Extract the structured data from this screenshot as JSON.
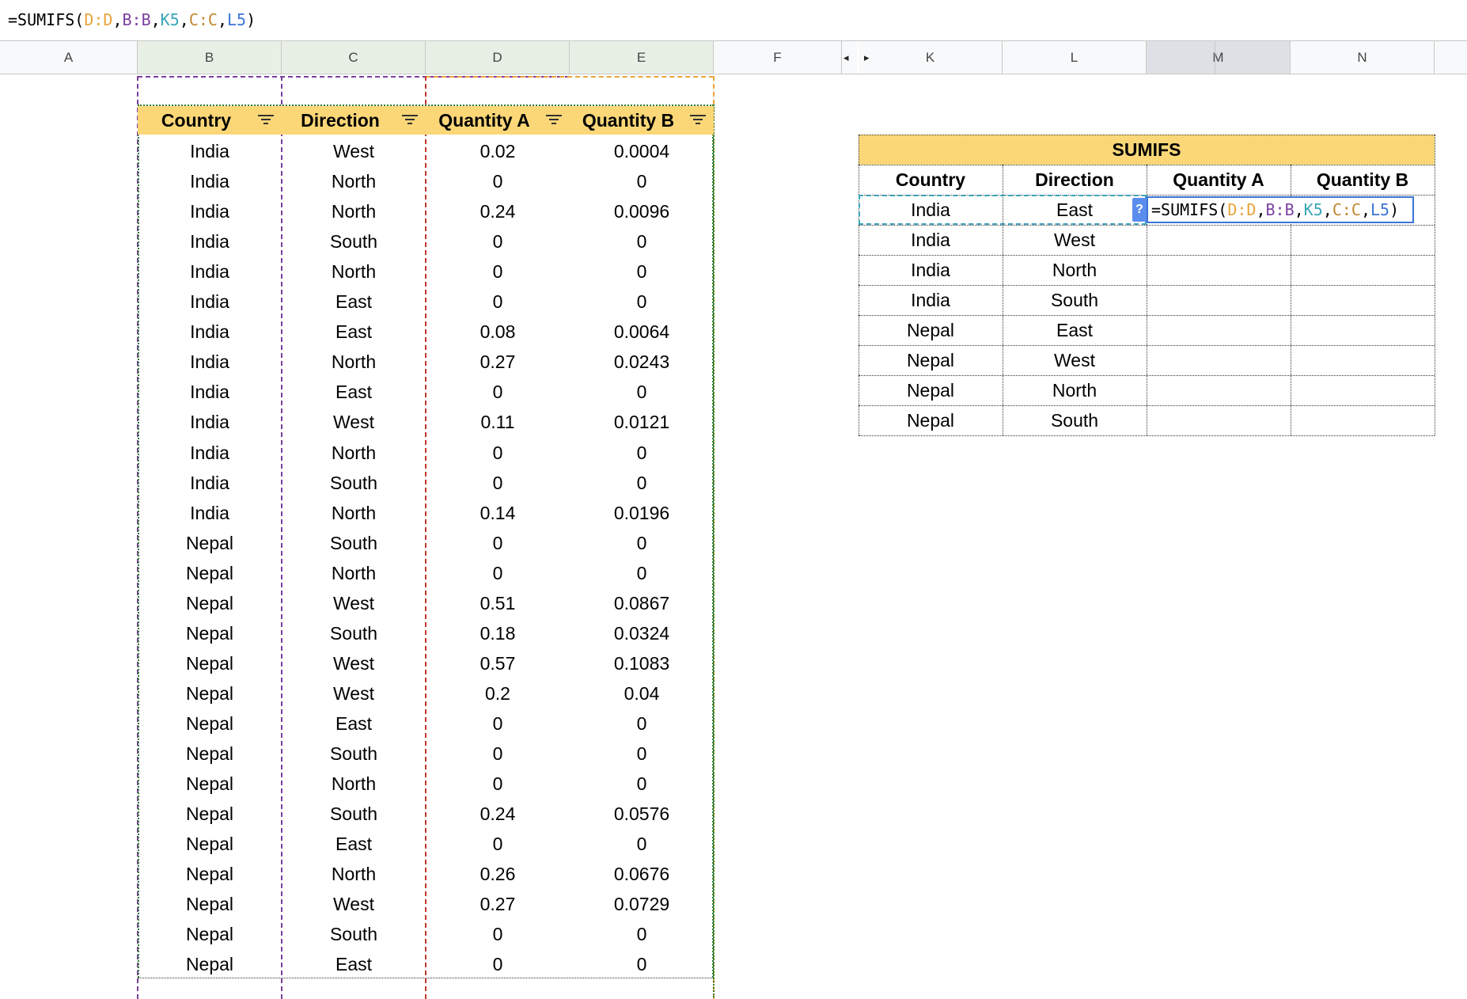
{
  "formula_bar": {
    "parts": [
      {
        "text": "=SUMIFS(",
        "color": ""
      },
      {
        "text": "D:D",
        "color": "#e8a33a"
      },
      {
        "text": ",",
        "color": ""
      },
      {
        "text": "B:B",
        "color": "#7b3fa0"
      },
      {
        "text": ",",
        "color": ""
      },
      {
        "text": "K5",
        "color": "#3aa6b9"
      },
      {
        "text": ",",
        "color": ""
      },
      {
        "text": "C:C",
        "color": "#c0872f"
      },
      {
        "text": ",",
        "color": ""
      },
      {
        "text": "L5",
        "color": "#3b74d6"
      },
      {
        "text": ")",
        "color": ""
      }
    ]
  },
  "column_headers": [
    "A",
    "B",
    "C",
    "D",
    "E",
    "F",
    "K",
    "L",
    "M",
    "N"
  ],
  "data_table": {
    "headers": [
      "Country",
      "Direction",
      "Quantity A",
      "Quantity B"
    ],
    "rows": [
      [
        "India",
        "West",
        "0.02",
        "0.0004"
      ],
      [
        "India",
        "North",
        "0",
        "0"
      ],
      [
        "India",
        "North",
        "0.24",
        "0.0096"
      ],
      [
        "India",
        "South",
        "0",
        "0"
      ],
      [
        "India",
        "North",
        "0",
        "0"
      ],
      [
        "India",
        "East",
        "0",
        "0"
      ],
      [
        "India",
        "East",
        "0.08",
        "0.0064"
      ],
      [
        "India",
        "North",
        "0.27",
        "0.0243"
      ],
      [
        "India",
        "East",
        "0",
        "0"
      ],
      [
        "India",
        "West",
        "0.11",
        "0.0121"
      ],
      [
        "India",
        "North",
        "0",
        "0"
      ],
      [
        "India",
        "South",
        "0",
        "0"
      ],
      [
        "India",
        "North",
        "0.14",
        "0.0196"
      ],
      [
        "Nepal",
        "South",
        "0",
        "0"
      ],
      [
        "Nepal",
        "North",
        "0",
        "0"
      ],
      [
        "Nepal",
        "West",
        "0.51",
        "0.0867"
      ],
      [
        "Nepal",
        "South",
        "0.18",
        "0.0324"
      ],
      [
        "Nepal",
        "West",
        "0.57",
        "0.1083"
      ],
      [
        "Nepal",
        "West",
        "0.2",
        "0.04"
      ],
      [
        "Nepal",
        "East",
        "0",
        "0"
      ],
      [
        "Nepal",
        "South",
        "0",
        "0"
      ],
      [
        "Nepal",
        "North",
        "0",
        "0"
      ],
      [
        "Nepal",
        "South",
        "0.24",
        "0.0576"
      ],
      [
        "Nepal",
        "East",
        "0",
        "0"
      ],
      [
        "Nepal",
        "North",
        "0.26",
        "0.0676"
      ],
      [
        "Nepal",
        "West",
        "0.27",
        "0.0729"
      ],
      [
        "Nepal",
        "South",
        "0",
        "0"
      ],
      [
        "Nepal",
        "East",
        "0",
        "0"
      ]
    ]
  },
  "summary_table": {
    "title": "SUMIFS",
    "headers": [
      "Country",
      "Direction",
      "Quantity A",
      "Quantity B"
    ],
    "rows": [
      [
        "India",
        "East"
      ],
      [
        "India",
        "West"
      ],
      [
        "India",
        "North"
      ],
      [
        "India",
        "South"
      ],
      [
        "Nepal",
        "East"
      ],
      [
        "Nepal",
        "West"
      ],
      [
        "Nepal",
        "North"
      ],
      [
        "Nepal",
        "South"
      ]
    ],
    "help_icon": "?"
  },
  "colors": {
    "header_fill": "#fbd778",
    "selection_blue": "#3b74d6",
    "border_green": "#2e7d32",
    "range_purple": "#7b3fa0",
    "range_red": "#c0392b",
    "range_orange": "#e8a33a"
  }
}
